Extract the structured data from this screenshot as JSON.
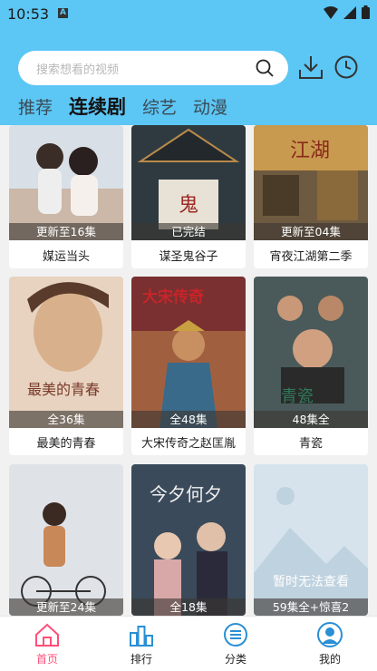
{
  "status": {
    "time": "10:53",
    "notif_letter": "A"
  },
  "search": {
    "placeholder": "搜索想看的视频"
  },
  "tabs": [
    {
      "label": "推荐",
      "active": false
    },
    {
      "label": "连续剧",
      "active": true
    },
    {
      "label": "综艺",
      "active": false
    },
    {
      "label": "动漫",
      "active": false
    }
  ],
  "cards": [
    {
      "title": "媒运当头",
      "badge": "更新至16集",
      "icon": "poster-couple"
    },
    {
      "title": "谋圣鬼谷子",
      "badge": "已完结",
      "icon": "poster-guiguzi"
    },
    {
      "title": "宵夜江湖第二季",
      "badge": "更新至04集",
      "icon": "poster-street-night"
    },
    {
      "title": "最美的青春",
      "badge": "全36集",
      "icon": "poster-face"
    },
    {
      "title": "大宋传奇之赵匡胤",
      "badge": "全48集",
      "icon": "poster-warrior",
      "poster_text": "大宋传奇"
    },
    {
      "title": "青瓷",
      "badge": "48集全",
      "icon": "poster-group",
      "poster_text": "青瓷"
    },
    {
      "title": "",
      "badge": "更新至24集",
      "icon": "poster-bicycle"
    },
    {
      "title": "",
      "badge": "全18集",
      "icon": "poster-costume",
      "poster_text": "今夕何夕"
    },
    {
      "title": "",
      "badge": "59集全+惊喜2",
      "icon": "poster-placeholder",
      "poster_text": "暂时无法查看"
    }
  ],
  "tabbar": [
    {
      "label": "首页",
      "active": true,
      "icon": "home-icon"
    },
    {
      "label": "排行",
      "active": false,
      "icon": "ranking-icon"
    },
    {
      "label": "分类",
      "active": false,
      "icon": "category-icon"
    },
    {
      "label": "我的",
      "active": false,
      "icon": "profile-icon"
    }
  ],
  "colors": {
    "header": "#5cc6f4",
    "accent": "#ff4f7a",
    "badge_bg": "#3c3732"
  }
}
